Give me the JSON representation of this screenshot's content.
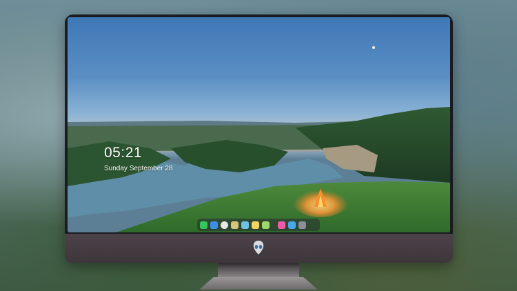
{
  "lock_screen": {
    "time": "05:21",
    "date": "Sunday September  28"
  },
  "dock": {
    "apps_left": [
      {
        "name": "messages-icon",
        "color": "#34c759"
      },
      {
        "name": "finder-icon",
        "color": "#3d8ee8"
      },
      {
        "name": "clock-icon",
        "color": "#e8e8e8"
      },
      {
        "name": "preview-icon",
        "color": "#d8c678"
      },
      {
        "name": "claquette-icon",
        "color": "#6fc2e6"
      },
      {
        "name": "notes-icon",
        "color": "#f4d35e"
      },
      {
        "name": "photos-icon",
        "color": "#9fd86a"
      }
    ],
    "apps_right": [
      {
        "name": "music-icon",
        "color": "#f05aa8"
      },
      {
        "name": "safari-icon",
        "color": "#4aa6ea"
      },
      {
        "name": "camera-icon",
        "color": "#8c8f96"
      }
    ]
  },
  "colors": {
    "bezel": "#1b1c22",
    "chin": "#453e43"
  }
}
